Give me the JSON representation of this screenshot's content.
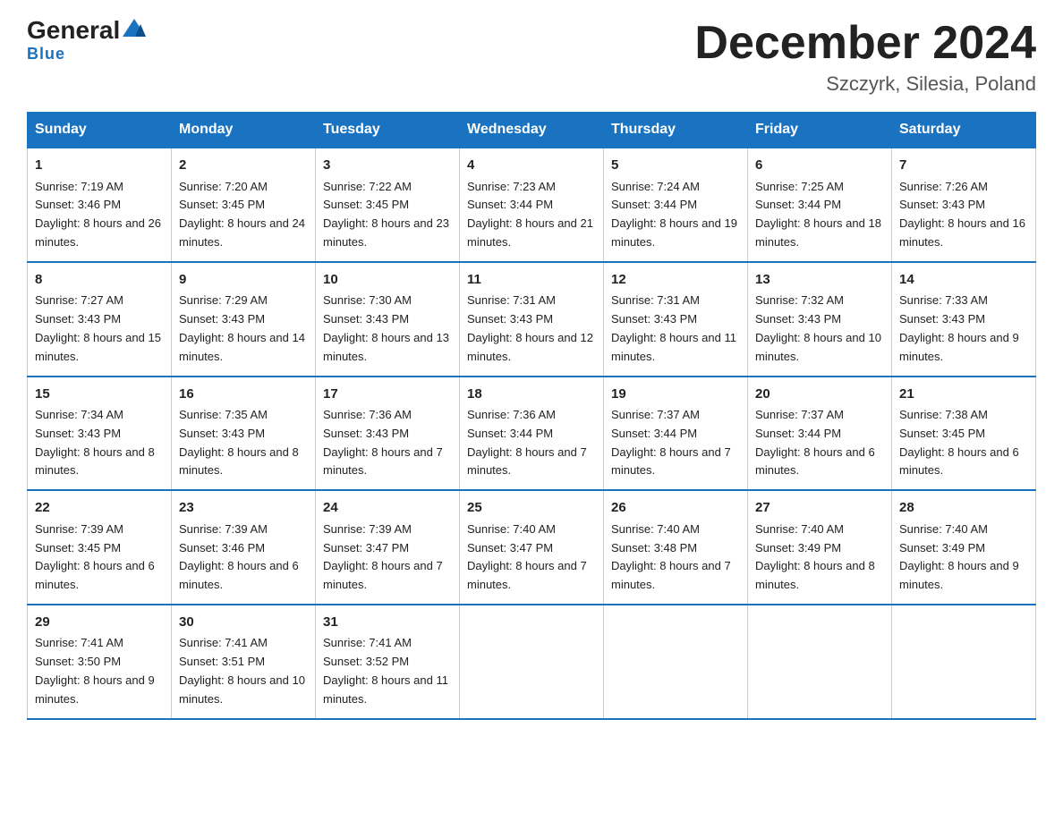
{
  "header": {
    "logo": {
      "general": "General",
      "blue": "Blue",
      "triangle": "▶"
    },
    "title": "December 2024",
    "location": "Szczyrk, Silesia, Poland"
  },
  "days_of_week": [
    "Sunday",
    "Monday",
    "Tuesday",
    "Wednesday",
    "Thursday",
    "Friday",
    "Saturday"
  ],
  "weeks": [
    [
      {
        "day": "1",
        "sunrise": "7:19 AM",
        "sunset": "3:46 PM",
        "daylight": "8 hours and 26 minutes."
      },
      {
        "day": "2",
        "sunrise": "7:20 AM",
        "sunset": "3:45 PM",
        "daylight": "8 hours and 24 minutes."
      },
      {
        "day": "3",
        "sunrise": "7:22 AM",
        "sunset": "3:45 PM",
        "daylight": "8 hours and 23 minutes."
      },
      {
        "day": "4",
        "sunrise": "7:23 AM",
        "sunset": "3:44 PM",
        "daylight": "8 hours and 21 minutes."
      },
      {
        "day": "5",
        "sunrise": "7:24 AM",
        "sunset": "3:44 PM",
        "daylight": "8 hours and 19 minutes."
      },
      {
        "day": "6",
        "sunrise": "7:25 AM",
        "sunset": "3:44 PM",
        "daylight": "8 hours and 18 minutes."
      },
      {
        "day": "7",
        "sunrise": "7:26 AM",
        "sunset": "3:43 PM",
        "daylight": "8 hours and 16 minutes."
      }
    ],
    [
      {
        "day": "8",
        "sunrise": "7:27 AM",
        "sunset": "3:43 PM",
        "daylight": "8 hours and 15 minutes."
      },
      {
        "day": "9",
        "sunrise": "7:29 AM",
        "sunset": "3:43 PM",
        "daylight": "8 hours and 14 minutes."
      },
      {
        "day": "10",
        "sunrise": "7:30 AM",
        "sunset": "3:43 PM",
        "daylight": "8 hours and 13 minutes."
      },
      {
        "day": "11",
        "sunrise": "7:31 AM",
        "sunset": "3:43 PM",
        "daylight": "8 hours and 12 minutes."
      },
      {
        "day": "12",
        "sunrise": "7:31 AM",
        "sunset": "3:43 PM",
        "daylight": "8 hours and 11 minutes."
      },
      {
        "day": "13",
        "sunrise": "7:32 AM",
        "sunset": "3:43 PM",
        "daylight": "8 hours and 10 minutes."
      },
      {
        "day": "14",
        "sunrise": "7:33 AM",
        "sunset": "3:43 PM",
        "daylight": "8 hours and 9 minutes."
      }
    ],
    [
      {
        "day": "15",
        "sunrise": "7:34 AM",
        "sunset": "3:43 PM",
        "daylight": "8 hours and 8 minutes."
      },
      {
        "day": "16",
        "sunrise": "7:35 AM",
        "sunset": "3:43 PM",
        "daylight": "8 hours and 8 minutes."
      },
      {
        "day": "17",
        "sunrise": "7:36 AM",
        "sunset": "3:43 PM",
        "daylight": "8 hours and 7 minutes."
      },
      {
        "day": "18",
        "sunrise": "7:36 AM",
        "sunset": "3:44 PM",
        "daylight": "8 hours and 7 minutes."
      },
      {
        "day": "19",
        "sunrise": "7:37 AM",
        "sunset": "3:44 PM",
        "daylight": "8 hours and 7 minutes."
      },
      {
        "day": "20",
        "sunrise": "7:37 AM",
        "sunset": "3:44 PM",
        "daylight": "8 hours and 6 minutes."
      },
      {
        "day": "21",
        "sunrise": "7:38 AM",
        "sunset": "3:45 PM",
        "daylight": "8 hours and 6 minutes."
      }
    ],
    [
      {
        "day": "22",
        "sunrise": "7:39 AM",
        "sunset": "3:45 PM",
        "daylight": "8 hours and 6 minutes."
      },
      {
        "day": "23",
        "sunrise": "7:39 AM",
        "sunset": "3:46 PM",
        "daylight": "8 hours and 6 minutes."
      },
      {
        "day": "24",
        "sunrise": "7:39 AM",
        "sunset": "3:47 PM",
        "daylight": "8 hours and 7 minutes."
      },
      {
        "day": "25",
        "sunrise": "7:40 AM",
        "sunset": "3:47 PM",
        "daylight": "8 hours and 7 minutes."
      },
      {
        "day": "26",
        "sunrise": "7:40 AM",
        "sunset": "3:48 PM",
        "daylight": "8 hours and 7 minutes."
      },
      {
        "day": "27",
        "sunrise": "7:40 AM",
        "sunset": "3:49 PM",
        "daylight": "8 hours and 8 minutes."
      },
      {
        "day": "28",
        "sunrise": "7:40 AM",
        "sunset": "3:49 PM",
        "daylight": "8 hours and 9 minutes."
      }
    ],
    [
      {
        "day": "29",
        "sunrise": "7:41 AM",
        "sunset": "3:50 PM",
        "daylight": "8 hours and 9 minutes."
      },
      {
        "day": "30",
        "sunrise": "7:41 AM",
        "sunset": "3:51 PM",
        "daylight": "8 hours and 10 minutes."
      },
      {
        "day": "31",
        "sunrise": "7:41 AM",
        "sunset": "3:52 PM",
        "daylight": "8 hours and 11 minutes."
      },
      null,
      null,
      null,
      null
    ]
  ]
}
